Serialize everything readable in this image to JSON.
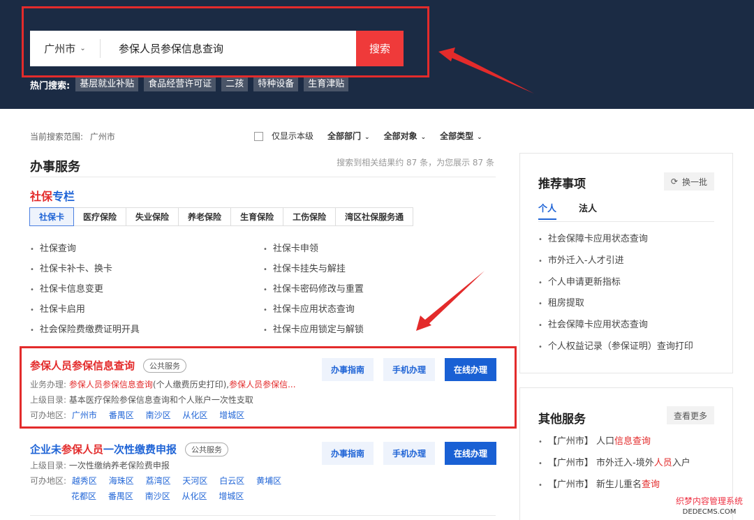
{
  "header": {
    "city": "广州市",
    "query": "参保人员参保信息查询",
    "search_label": "搜索",
    "hot_label": "热门搜索:",
    "hot_tags": [
      "基层就业补贴",
      "食品经营许可证",
      "二孩",
      "特种设备",
      "生育津贴"
    ]
  },
  "filters": {
    "scope_label": "当前搜索范围:",
    "scope_value": "广州市",
    "only_this_level": "仅显示本级",
    "dept": "全部部门",
    "target": "全部对象",
    "type": "全部类型"
  },
  "main": {
    "section_title": "办事服务",
    "result_count": "搜索到相关结果约 87 条，为您展示 87 条",
    "special_title_red": "社保",
    "special_title_blue": "专栏",
    "tabs": [
      "社保卡",
      "医疗保险",
      "失业保险",
      "养老保险",
      "生育保险",
      "工伤保险",
      "湾区社保服务通"
    ],
    "links": [
      "社保查询",
      "社保卡申领",
      "社保卡补卡、换卡",
      "社保卡挂失与解挂",
      "社保卡信息变更",
      "社保卡密码修改与重置",
      "社保卡启用",
      "社保卡应用状态查询",
      "社会保险费缴费证明开具",
      "社保卡应用锁定与解锁"
    ]
  },
  "card1": {
    "title": "参保人员参保信息查询",
    "badge": "公共服务",
    "biz_label": "业务办理:",
    "biz_red1": "参保人员参保信息查询",
    "biz_mid": "(个人缴费历史打印),",
    "biz_red2": "参保人员参保信...",
    "parent_label": "上级目录:",
    "parent_value": "基本医疗保险参保信息查询和个人账户一次性支取",
    "area_label": "可办地区:",
    "areas": [
      "广州市",
      "番禺区",
      "南沙区",
      "从化区",
      "增城区"
    ],
    "btn_guide": "办事指南",
    "btn_mobile": "手机办理",
    "btn_online": "在线办理"
  },
  "card2": {
    "title_a": "企业未",
    "title_red": "参保人员",
    "title_b": "一次性缴费申报",
    "badge": "公共服务",
    "parent_label": "上级目录:",
    "parent_value": "一次性缴纳养老保险费申报",
    "area_label": "可办地区:",
    "areas_row1": [
      "越秀区",
      "海珠区",
      "荔湾区",
      "天河区",
      "白云区",
      "黄埔区"
    ],
    "areas_row2": [
      "花都区",
      "番禺区",
      "南沙区",
      "从化区",
      "增城区"
    ],
    "btn_guide": "办事指南",
    "btn_mobile": "手机办理",
    "btn_online": "在线办理"
  },
  "recommend": {
    "title": "推荐事项",
    "refresh": "换一批",
    "tab_personal": "个人",
    "tab_legal": "法人",
    "items": [
      "社会保障卡应用状态查询",
      "市外迁入-人才引进",
      "个人申请更新指标",
      "租房提取",
      "社会保障卡应用状态查询",
      "个人权益记录（参保证明）查询打印"
    ]
  },
  "other": {
    "title": "其他服务",
    "more": "查看更多",
    "items": [
      {
        "prefix": "【广州市】 人口",
        "red": "信息查询",
        "suffix": ""
      },
      {
        "prefix": "【广州市】 市外迁入-境外",
        "red": "人员",
        "suffix": "入户"
      },
      {
        "prefix": "【广州市】 新生儿重名",
        "red": "查询",
        "suffix": ""
      }
    ]
  },
  "watermark": {
    "line1": "织梦内容管理系统",
    "line2": "DEDECMS.COM"
  },
  "colors": {
    "header_bg": "#1b2b44",
    "accent_red": "#e32b2b",
    "accent_blue": "#1f64d6",
    "search_btn": "#ef3a3a"
  }
}
